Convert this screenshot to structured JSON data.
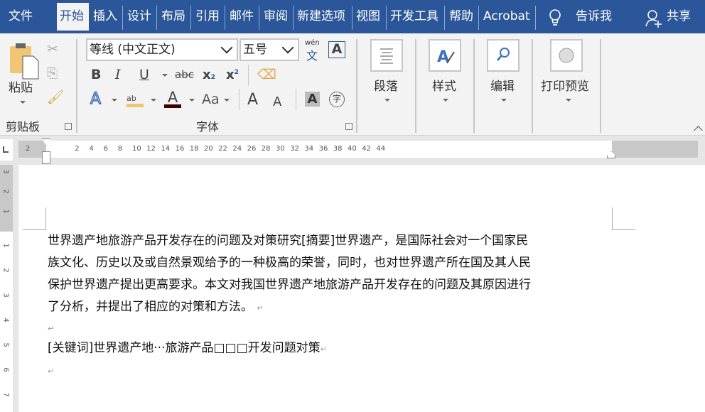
{
  "tabs": [
    {
      "label": "文件"
    },
    {
      "label": "开始",
      "active": true
    },
    {
      "label": "插入"
    },
    {
      "label": "设计"
    },
    {
      "label": "布局"
    },
    {
      "label": "引用"
    },
    {
      "label": "邮件"
    },
    {
      "label": "审阅"
    },
    {
      "label": "新建选项"
    },
    {
      "label": "视图"
    },
    {
      "label": "开发工具"
    },
    {
      "label": "帮助"
    },
    {
      "label": "Acrobat"
    }
  ],
  "tell_me": "告诉我",
  "share": "共享",
  "clipboard": {
    "paste": "粘贴",
    "group": "剪贴板"
  },
  "font": {
    "name": "等线 (中文正文)",
    "size": "五号",
    "phonetic_top": "wén",
    "phonetic_bottom": "文",
    "group": "字体",
    "bold": "B",
    "italic": "I",
    "underline": "U",
    "strike": "abc",
    "sub": "x",
    "sub2": "2",
    "sup": "x",
    "sup2": "2",
    "effects": "A",
    "highlight": "ab",
    "color": "A",
    "case": "Aa",
    "grow": "A",
    "shrink": "A",
    "shade": "A",
    "enclose": "字",
    "border_a": "A"
  },
  "groups": {
    "paragraph": "段落",
    "styles": "样式",
    "editing": "编辑",
    "print_preview": "打印预览"
  },
  "colors": {
    "accent": "#2b579a",
    "font_color": "#3b0000",
    "highlight": "#f0c674"
  },
  "ruler": [
    "2",
    "2",
    "4",
    "6",
    "8",
    "10",
    "12",
    "14",
    "16",
    "18",
    "20",
    "22",
    "24",
    "26",
    "28",
    "30",
    "32",
    "34",
    "36",
    "38",
    "40",
    "42",
    "44"
  ],
  "vruler": [
    "3",
    "2",
    "1",
    "1",
    "2",
    "3",
    "4",
    "5",
    "6",
    "7"
  ],
  "document": {
    "lines": [
      "世界遗产地旅游产品开发存在的问题及对策研究[摘要]世界遗产，是国际社会对一个国家民",
      "族文化、历史以及或自然景观给予的一种极高的荣誉，同时，也对世界遗产所在国及其人民",
      "保护世界遗产提出更高要求。本文对我国世界遗产地旅游产品开发存在的问题及其原因进行",
      "了分析，并提出了相应的对策和方法。"
    ],
    "keywords": "[关键词]世界遗产地···旅游产品□□□开发问题对策",
    "para_mark": "↵"
  }
}
